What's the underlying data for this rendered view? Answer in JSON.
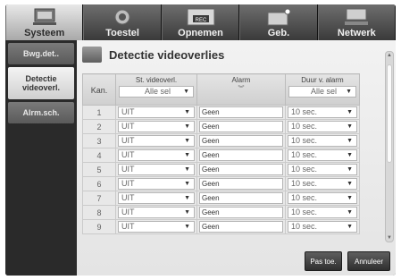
{
  "tabs": [
    {
      "label": "Systeem",
      "icon": "system-icon",
      "active": true
    },
    {
      "label": "Toestel",
      "icon": "device-icon",
      "active": false
    },
    {
      "label": "Opnemen",
      "icon": "record-icon",
      "active": false,
      "icon_text": "REC"
    },
    {
      "label": "Geb.",
      "icon": "event-icon",
      "active": false
    },
    {
      "label": "Netwerk",
      "icon": "network-icon",
      "active": false
    }
  ],
  "sidebar": {
    "items": [
      {
        "label": "Bwg.det..",
        "active": false
      },
      {
        "label": "Detectie videoverl.",
        "active": true
      },
      {
        "label": "Alrm.sch.",
        "active": false
      }
    ]
  },
  "page": {
    "title": "Detectie videoverlies"
  },
  "table": {
    "headers": {
      "kan": "Kan.",
      "st_videoverl": "St. videoverl.",
      "alarm": "Alarm",
      "duur": "Duur v. alarm"
    },
    "header_selects": {
      "st_videoverl": "Alle sel",
      "duur": "Alle sel"
    },
    "rows": [
      {
        "kan": "1",
        "st": "UIT",
        "alarm": "Geen",
        "duur": "10 sec."
      },
      {
        "kan": "2",
        "st": "UIT",
        "alarm": "Geen",
        "duur": "10 sec."
      },
      {
        "kan": "3",
        "st": "UIT",
        "alarm": "Geen",
        "duur": "10 sec."
      },
      {
        "kan": "4",
        "st": "UIT",
        "alarm": "Geen",
        "duur": "10 sec."
      },
      {
        "kan": "5",
        "st": "UIT",
        "alarm": "Geen",
        "duur": "10 sec."
      },
      {
        "kan": "6",
        "st": "UIT",
        "alarm": "Geen",
        "duur": "10 sec."
      },
      {
        "kan": "7",
        "st": "UIT",
        "alarm": "Geen",
        "duur": "10 sec."
      },
      {
        "kan": "8",
        "st": "UIT",
        "alarm": "Geen",
        "duur": "10 sec."
      },
      {
        "kan": "9",
        "st": "UIT",
        "alarm": "Geen",
        "duur": "10 sec."
      }
    ]
  },
  "buttons": {
    "apply": "Pas toe.",
    "cancel": "Annuleer"
  }
}
